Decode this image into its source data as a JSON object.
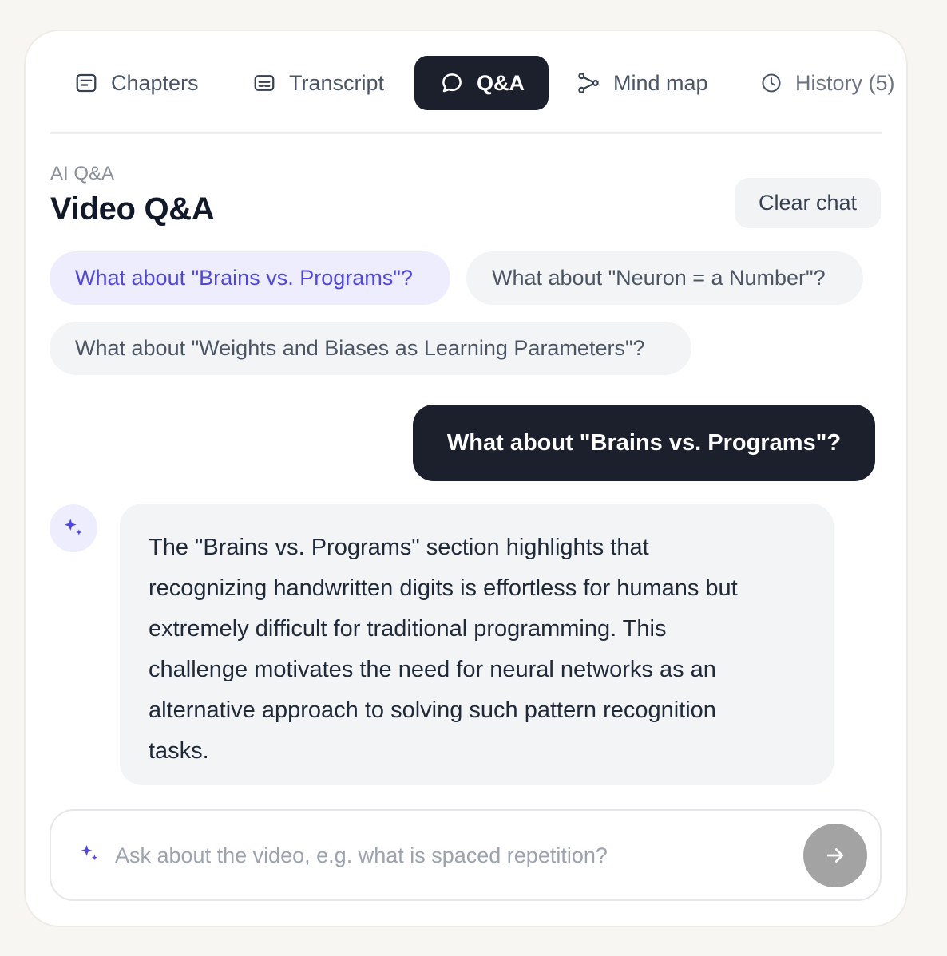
{
  "tabs": [
    {
      "label": "Chapters",
      "icon": "chapters-icon"
    },
    {
      "label": "Transcript",
      "icon": "transcript-icon"
    },
    {
      "label": "Q&A",
      "icon": "chat-bubble-icon",
      "active": true
    },
    {
      "label": "Mind map",
      "icon": "mind-map-icon"
    },
    {
      "label": "History (5)",
      "icon": "clock-icon"
    }
  ],
  "header": {
    "eyebrow": "AI Q&A",
    "title": "Video Q&A",
    "clear_label": "Clear chat"
  },
  "suggestions": [
    {
      "label": "What about \"Brains vs. Programs\"?",
      "selected": true
    },
    {
      "label": "What about \"Neuron = a Number\"?",
      "selected": false
    },
    {
      "label": "What about \"Weights and Biases as Learning Parameters\"?",
      "selected": false
    }
  ],
  "conversation": {
    "user_message": "What about \"Brains vs. Programs\"?",
    "ai_icon": "sparkle-icon",
    "ai_lines": [
      "The \"Brains vs. Programs\" section highlights that",
      "recognizing handwritten digits is effortless for humans but",
      "extremely difficult for traditional programming. This",
      "challenge motivates the need for neural networks as an",
      "alternative approach to solving such pattern recognition",
      "tasks."
    ]
  },
  "input": {
    "value": "",
    "placeholder": "Ask about the video, e.g. what is spaced repetition?",
    "send_icon": "arrow-right-icon"
  },
  "colors": {
    "active_tab": "#1c1f2c",
    "accent": "#4f46e5",
    "chip_selected_bg": "#eeedfd",
    "send_button": "#a3a3a3"
  }
}
